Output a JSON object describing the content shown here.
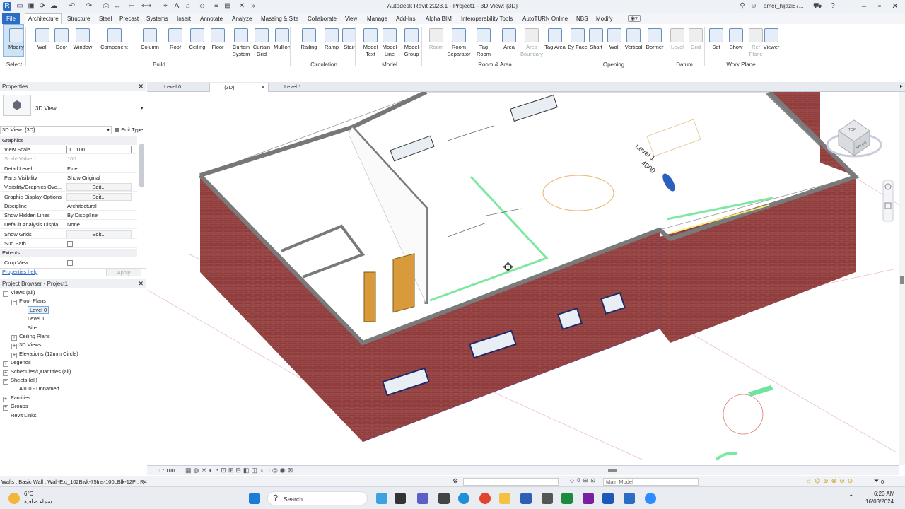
{
  "app": {
    "title": "Autodesk Revit 2023.1 - Project1 - 3D View: {3D}",
    "user": "amer_hijazi87..."
  },
  "menu": [
    "File",
    "Architecture",
    "Structure",
    "Steel",
    "Precast",
    "Systems",
    "Insert",
    "Annotate",
    "Analyze",
    "Massing & Site",
    "Collaborate",
    "View",
    "Manage",
    "Add-Ins",
    "Alpha BIM",
    "Interoperability Tools",
    "AutoTURN Online",
    "NBS",
    "Modify"
  ],
  "ribbon": {
    "tools": [
      {
        "label": "Modify",
        "icon": "arrow-cursor-icon"
      },
      {
        "label": "Wall",
        "icon": "wall-icon"
      },
      {
        "label": "Door",
        "icon": "door-icon"
      },
      {
        "label": "Window",
        "icon": "window-icon"
      },
      {
        "label": "Component",
        "icon": "component-icon"
      },
      {
        "label": "Column",
        "icon": "column-icon"
      },
      {
        "label": "Roof",
        "icon": "roof-icon"
      },
      {
        "label": "Ceiling",
        "icon": "ceiling-icon"
      },
      {
        "label": "Floor",
        "icon": "floor-icon"
      },
      {
        "label": "Curtain System",
        "icon": "curtain-system-icon"
      },
      {
        "label": "Curtain Grid",
        "icon": "curtain-grid-icon"
      },
      {
        "label": "Mullion",
        "icon": "mullion-icon"
      },
      {
        "label": "Railing",
        "icon": "railing-icon"
      },
      {
        "label": "Ramp",
        "icon": "ramp-icon"
      },
      {
        "label": "Stair",
        "icon": "stair-icon"
      },
      {
        "label": "Model Text",
        "icon": "model-text-icon"
      },
      {
        "label": "Model Line",
        "icon": "model-line-icon"
      },
      {
        "label": "Model Group",
        "icon": "model-group-icon"
      },
      {
        "label": "Room",
        "icon": "room-icon",
        "disabled": true
      },
      {
        "label": "Room Separator",
        "icon": "room-separator-icon"
      },
      {
        "label": "Tag Room",
        "icon": "tag-room-icon"
      },
      {
        "label": "Area",
        "icon": "area-icon"
      },
      {
        "label": "Area Boundary",
        "icon": "area-boundary-icon",
        "disabled": true
      },
      {
        "label": "Tag Area",
        "icon": "tag-area-icon"
      },
      {
        "label": "By Face",
        "icon": "by-face-icon"
      },
      {
        "label": "Shaft",
        "icon": "shaft-icon"
      },
      {
        "label": "Wall",
        "icon": "wall-opening-icon"
      },
      {
        "label": "Vertical",
        "icon": "vertical-icon"
      },
      {
        "label": "Dormer",
        "icon": "dormer-icon"
      },
      {
        "label": "Level",
        "icon": "level-icon",
        "disabled": true
      },
      {
        "label": "Grid",
        "icon": "grid-icon",
        "disabled": true
      },
      {
        "label": "Set",
        "icon": "set-icon"
      },
      {
        "label": "Show",
        "icon": "show-icon"
      },
      {
        "label": "Ref Plane",
        "icon": "ref-plane-icon",
        "disabled": true
      },
      {
        "label": "Viewer",
        "icon": "viewer-icon"
      }
    ],
    "panels": [
      "Select",
      "Build",
      "Circulation",
      "Model",
      "Room & Area",
      "Opening",
      "Datum",
      "Work Plane"
    ]
  },
  "doc_tabs": [
    {
      "label": "Level 0",
      "active": false
    },
    {
      "label": "{3D}",
      "active": true
    },
    {
      "label": "Level 1",
      "active": false
    }
  ],
  "properties": {
    "header": "Properties",
    "type": "3D View",
    "instance": "3D View: {3D}",
    "edit_type": "Edit Type",
    "categories": [
      "Graphics",
      "Extents"
    ],
    "rows": [
      {
        "k": "View Scale",
        "v": "1 : 100",
        "style": "input"
      },
      {
        "k": "Scale Value    1:",
        "v": "100",
        "style": "dim"
      },
      {
        "k": "Detail Level",
        "v": "Fine"
      },
      {
        "k": "Parts Visibility",
        "v": "Show Original"
      },
      {
        "k": "Visibility/Graphics Ove...",
        "v": "Edit...",
        "style": "edit"
      },
      {
        "k": "Graphic Display Options",
        "v": "Edit...",
        "style": "edit"
      },
      {
        "k": "Discipline",
        "v": "Architectural"
      },
      {
        "k": "Show Hidden Lines",
        "v": "By Discipline"
      },
      {
        "k": "Default Analysis Displa...",
        "v": "None"
      },
      {
        "k": "Show Grids",
        "v": "Edit...",
        "style": "edit"
      },
      {
        "k": "Sun Path",
        "v": "",
        "style": "checkbox"
      }
    ],
    "extent_rows": [
      {
        "k": "Crop View",
        "v": "",
        "style": "checkbox"
      }
    ],
    "help": "Properties help",
    "apply": "Apply"
  },
  "browser": {
    "header": "Project Browser - Project1",
    "items": [
      {
        "label": "Views (all)",
        "level": 0,
        "toggle": "-"
      },
      {
        "label": "Floor Plans",
        "level": 1,
        "toggle": "-"
      },
      {
        "label": "Level 0",
        "level": 2,
        "bold": true
      },
      {
        "label": "Level 1",
        "level": 2
      },
      {
        "label": "Site",
        "level": 2
      },
      {
        "label": "Ceiling Plans",
        "level": 1,
        "toggle": "+"
      },
      {
        "label": "3D Views",
        "level": 1,
        "toggle": "+"
      },
      {
        "label": "Elevations (12mm Circle)",
        "level": 1,
        "toggle": "+"
      },
      {
        "label": "Legends",
        "level": 0,
        "toggle": "+"
      },
      {
        "label": "Schedules/Quantities (all)",
        "level": 0,
        "toggle": "+"
      },
      {
        "label": "Sheets (all)",
        "level": 0,
        "toggle": "-"
      },
      {
        "label": "A100 - Unnamed",
        "level": 1
      },
      {
        "label": "Families",
        "level": 0,
        "toggle": "+"
      },
      {
        "label": "Groups",
        "level": 0,
        "toggle": "+"
      },
      {
        "label": "Revit Links",
        "level": 0
      }
    ]
  },
  "viewport": {
    "level_name": "Level 1",
    "level_elev": "4000",
    "viewcube_top": "TOP",
    "viewcube_front": "FRONT"
  },
  "view_bar": {
    "scale": "1 : 100"
  },
  "status": {
    "text": "Walls : Basic Wall : Wall-Ext_102Bwk-75Ins-100LBlk-12P : R4",
    "workset": "Main Model",
    "filter_count": "0"
  },
  "taskbar": {
    "weather_temp": "6°C",
    "weather_text": "سماء صافية",
    "search": "Search",
    "time": "6:23 AM",
    "date": "16/03/2024"
  },
  "colors": {
    "brick": "#8b3a3a",
    "accent": "#2b6cc4",
    "green": "#5fe08a",
    "wall": "#7a7a7a"
  }
}
